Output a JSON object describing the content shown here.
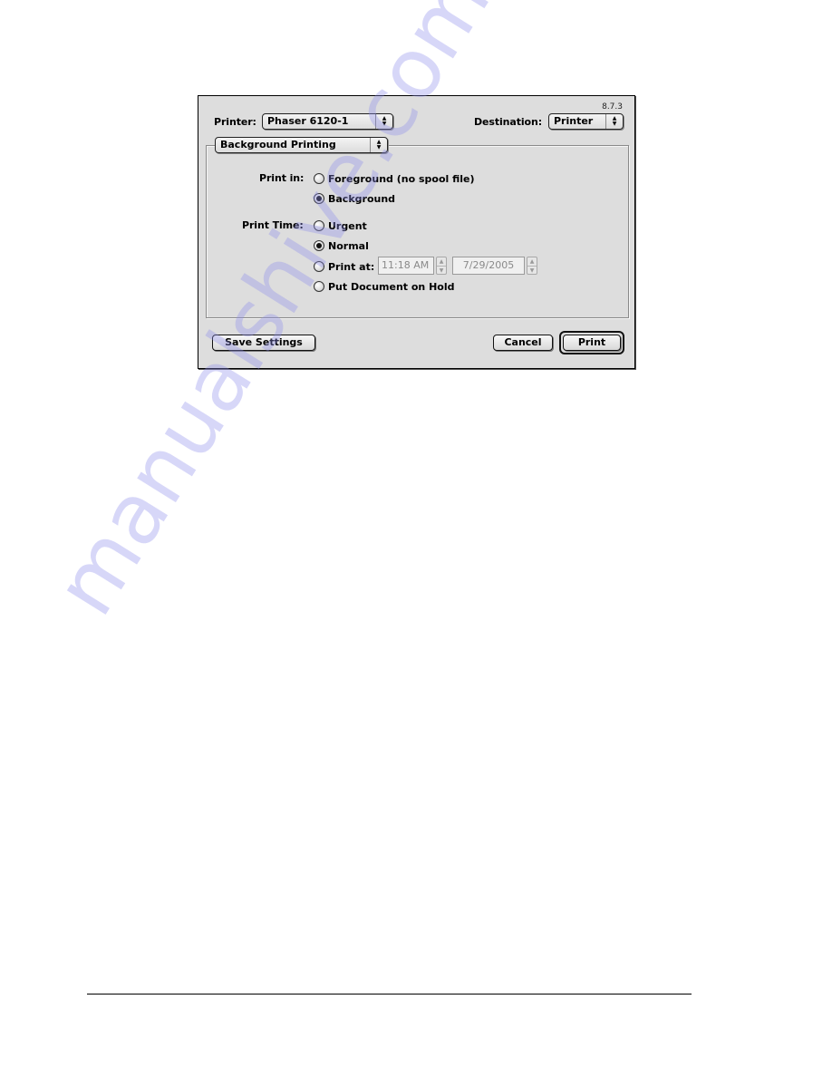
{
  "dialog": {
    "version": "8.7.3",
    "printer": {
      "label": "Printer:",
      "value": "Phaser 6120-1"
    },
    "destination": {
      "label": "Destination:",
      "value": "Printer"
    },
    "panel_selector": {
      "value": "Background Printing"
    },
    "print_in": {
      "label": "Print in:",
      "options": [
        {
          "label": "Foreground (no spool file)",
          "selected": false
        },
        {
          "label": "Background",
          "selected": true
        }
      ]
    },
    "print_time": {
      "label": "Print Time:",
      "options": [
        {
          "label": "Urgent",
          "selected": false
        },
        {
          "label": "Normal",
          "selected": true
        },
        {
          "label": "Print at:",
          "selected": false
        },
        {
          "label": "Put Document on Hold",
          "selected": false
        }
      ],
      "time_value": "11:18 AM",
      "date_value": "7/29/2005"
    },
    "buttons": {
      "save_settings": "Save Settings",
      "cancel": "Cancel",
      "print": "Print"
    }
  },
  "icons": {
    "popup_arrows": "up-down-arrows-icon",
    "stepper": "stepper-arrows-icon",
    "radio": "radio-button-icon"
  },
  "watermark": {
    "text": "manualshive.com"
  }
}
